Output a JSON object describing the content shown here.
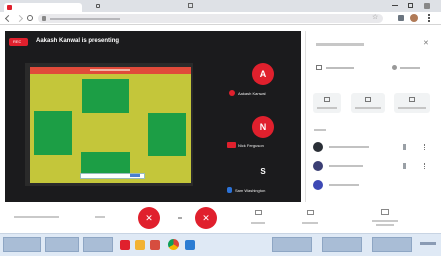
{
  "meeting": {
    "title": "Aakash Kanwal is presenting",
    "rec_badge": "REC"
  },
  "participants": [
    {
      "initial": "A",
      "name": "Aakash Kanwal"
    },
    {
      "initial": "N",
      "name": "Nick Ferguson"
    },
    {
      "initial": "S",
      "name": "Sam Washington"
    }
  ],
  "colors": {
    "accent": "#e0202d",
    "stage_bg": "#1b1b1d",
    "slide_bg": "#c4c63a",
    "slide_block": "#1c9e45"
  }
}
